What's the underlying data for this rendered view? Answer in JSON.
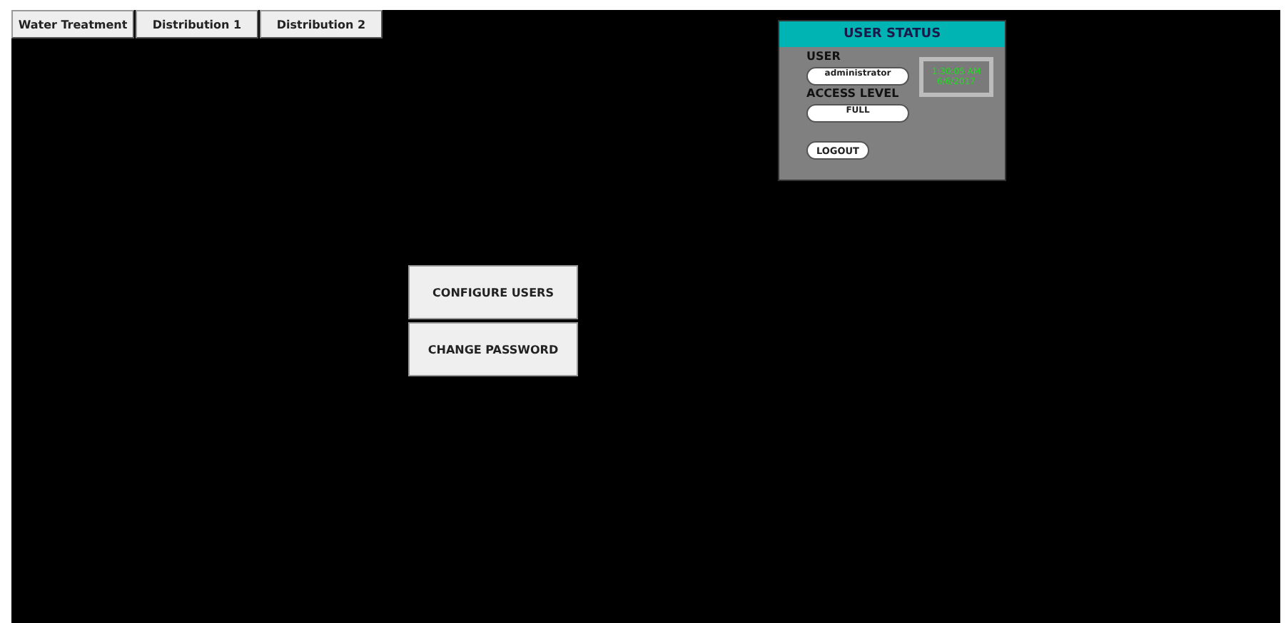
{
  "tabs": [
    {
      "label": "Water Treatment"
    },
    {
      "label": "Distribution 1"
    },
    {
      "label": "Distribution 2"
    }
  ],
  "user_status": {
    "title": "USER STATUS",
    "user_label": "USER",
    "user": "administrator",
    "access_label": "ACCESS LEVEL",
    "access": "FULL",
    "logout": "LOGOUT",
    "time": "1:30:05 AM",
    "date": "6/6/2017"
  },
  "buttons": [
    "CONFIGURE USERS",
    "CHANGE PASSWORD"
  ]
}
